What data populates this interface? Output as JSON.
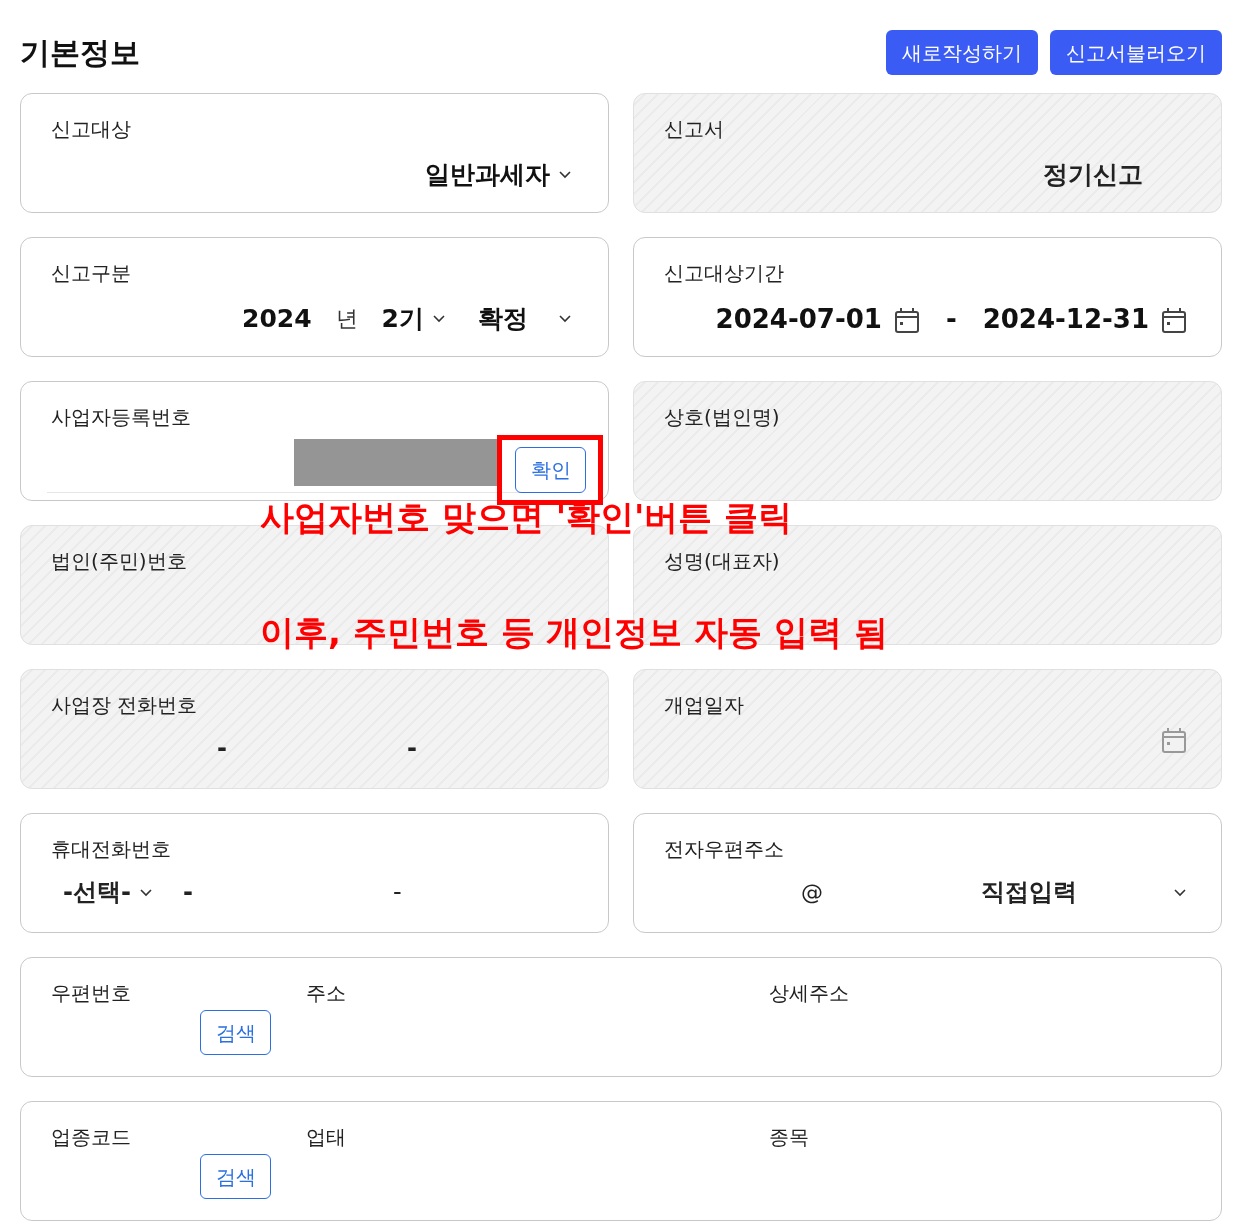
{
  "title": "기본정보",
  "buttons": [
    {
      "label": "새로작성하기"
    },
    {
      "label": "신고서불러오기"
    }
  ],
  "fields": [
    {
      "kind": "select",
      "label": "신고대상",
      "disabled": false,
      "value": "일반과세자"
    },
    {
      "kind": "text",
      "label": "신고서",
      "disabled": true,
      "value": "정기신고"
    },
    {
      "kind": "period",
      "label": "신고구분",
      "disabled": false,
      "year": "2024",
      "year_unit": "년",
      "term": "2기",
      "type": "확정"
    },
    {
      "kind": "daterange",
      "label": "신고대상기간",
      "disabled": false,
      "start": "2024-07-01",
      "separator": "-",
      "end": "2024-12-31"
    },
    {
      "kind": "bizno",
      "label": "사업자등록번호",
      "disabled": false,
      "button": "확인",
      "highlighted": true
    },
    {
      "kind": "text",
      "label": "상호(법인명)",
      "disabled": true
    },
    {
      "kind": "text",
      "label": "법인(주민)번호",
      "disabled": true
    },
    {
      "kind": "text",
      "label": "성명(대표자)",
      "disabled": true
    },
    {
      "kind": "phone",
      "label": "사업장 전화번호",
      "disabled": true,
      "separators": [
        "-",
        "-"
      ]
    },
    {
      "kind": "date",
      "label": "개업일자",
      "disabled": true
    },
    {
      "kind": "phone",
      "label": "휴대전화번호",
      "disabled": false,
      "prefix": "-선택-",
      "separators": [
        "-",
        "-"
      ]
    },
    {
      "kind": "email",
      "label": "전자우편주소",
      "disabled": false,
      "at": "@",
      "domain": "직접입력"
    }
  ],
  "wide_rows": [
    {
      "columns": [
        {
          "label": "우편번호",
          "button": "검색"
        },
        {
          "label": "주소"
        },
        {
          "label": "상세주소"
        }
      ]
    },
    {
      "columns": [
        {
          "label": "업종코드",
          "button": "검색"
        },
        {
          "label": "업태"
        },
        {
          "label": "종목"
        }
      ]
    }
  ],
  "annotations": [
    "사업자번호 맞으면 '확인'버튼 클릭",
    "이후, 주민번호 등 개인정보 자동 입력 됨"
  ]
}
